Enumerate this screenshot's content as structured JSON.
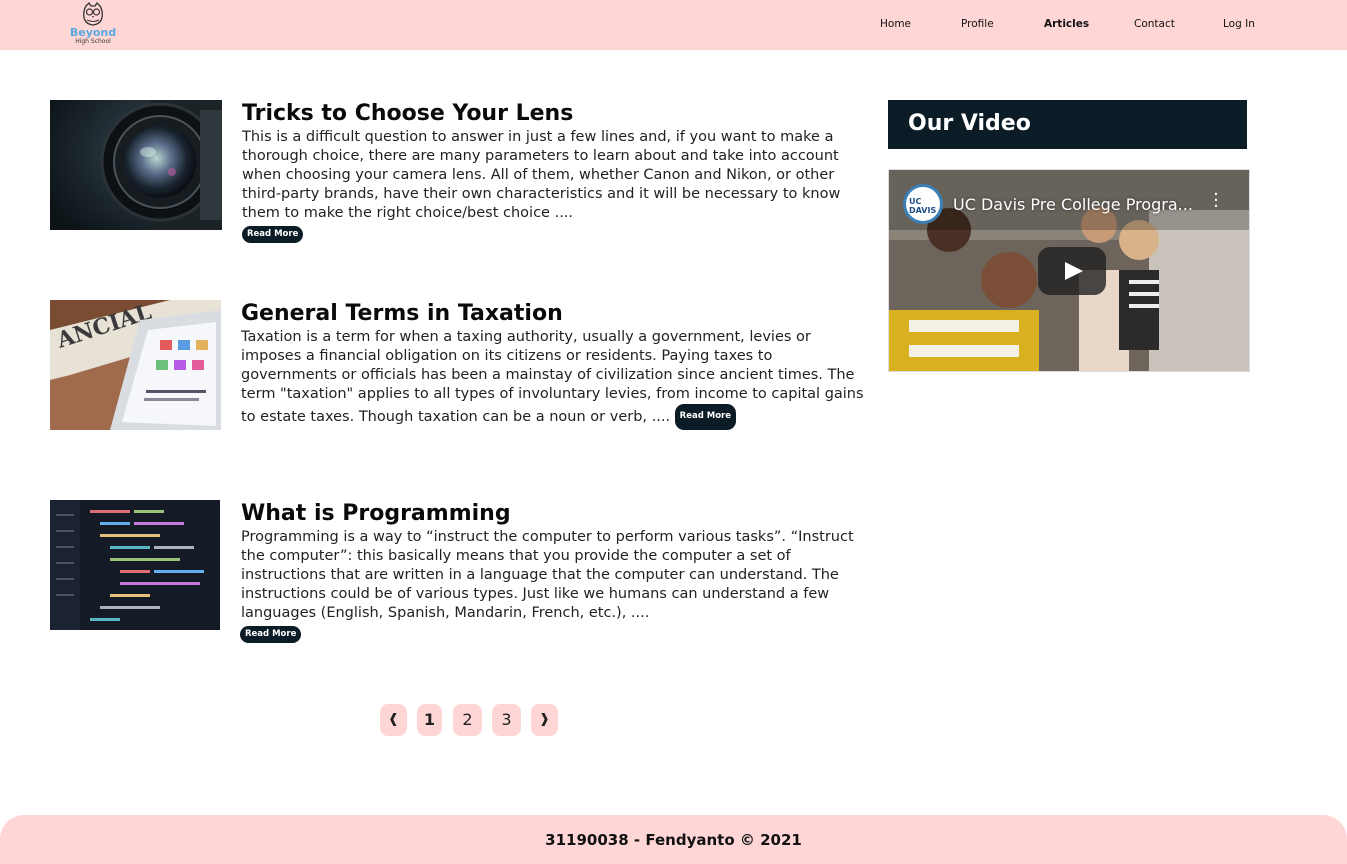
{
  "header": {
    "logo": {
      "brand": "Beyond",
      "sub": "High School",
      "icon": "owl-icon"
    },
    "nav": [
      {
        "label": "Home",
        "active": false
      },
      {
        "label": "Profile",
        "active": false
      },
      {
        "label": "Articles",
        "active": true
      },
      {
        "label": "Contact",
        "active": false
      },
      {
        "label": "Log In",
        "active": false
      }
    ]
  },
  "articles": [
    {
      "title": "Tricks to Choose Your Lens",
      "excerpt": "This is a difficult question to answer in just a few lines and, if you want to make a thorough choice, there are many parameters to learn about and take into account when choosing your camera lens. All of them, whether Canon and Nikon, or other third-party brands, have their own characteristics and it will be necessary to know them to make the right choice/best choice ....",
      "read_more": "Read More",
      "image": "camera-lens-photo"
    },
    {
      "title": "General Terms in Taxation",
      "excerpt": "Taxation is a term for when a taxing authority, usually a government, levies or imposes a financial obligation on its citizens or residents. Paying taxes to governments or officials has been a mainstay of civilization since ancient times. The term \"taxation\" applies to all types of involuntary levies, from income to capital gains to estate taxes. Though taxation can be a noun or verb, ....",
      "read_more": "Read More",
      "image": "tablet-newspaper-photo"
    },
    {
      "title": "What is Programming",
      "excerpt": "Programming is a way to “instruct the computer to perform various tasks”. “Instruct the computer”: this basically means that you provide the computer a set of instructions that are written in a language that the computer can understand. The instructions could be of various types. Just like we humans can understand a few languages (English, Spanish, Mandarin, French, etc.), ....",
      "read_more": "Read More",
      "image": "code-screen-photo"
    }
  ],
  "pagination": {
    "prev": "❰",
    "pages": [
      "1",
      "2",
      "3"
    ],
    "current": "1",
    "next": "❱"
  },
  "sidebar": {
    "title": "Our Video",
    "video": {
      "title": "UC Davis Pre College Progra...",
      "channel_badge": "UC DAVIS"
    }
  },
  "footer": {
    "text": "31190038 - Fendyanto © 2021"
  },
  "colors": {
    "header_bg": "#ffd6d6",
    "dark": "#0b1c26",
    "accent_logo": "#5aa8e0"
  }
}
